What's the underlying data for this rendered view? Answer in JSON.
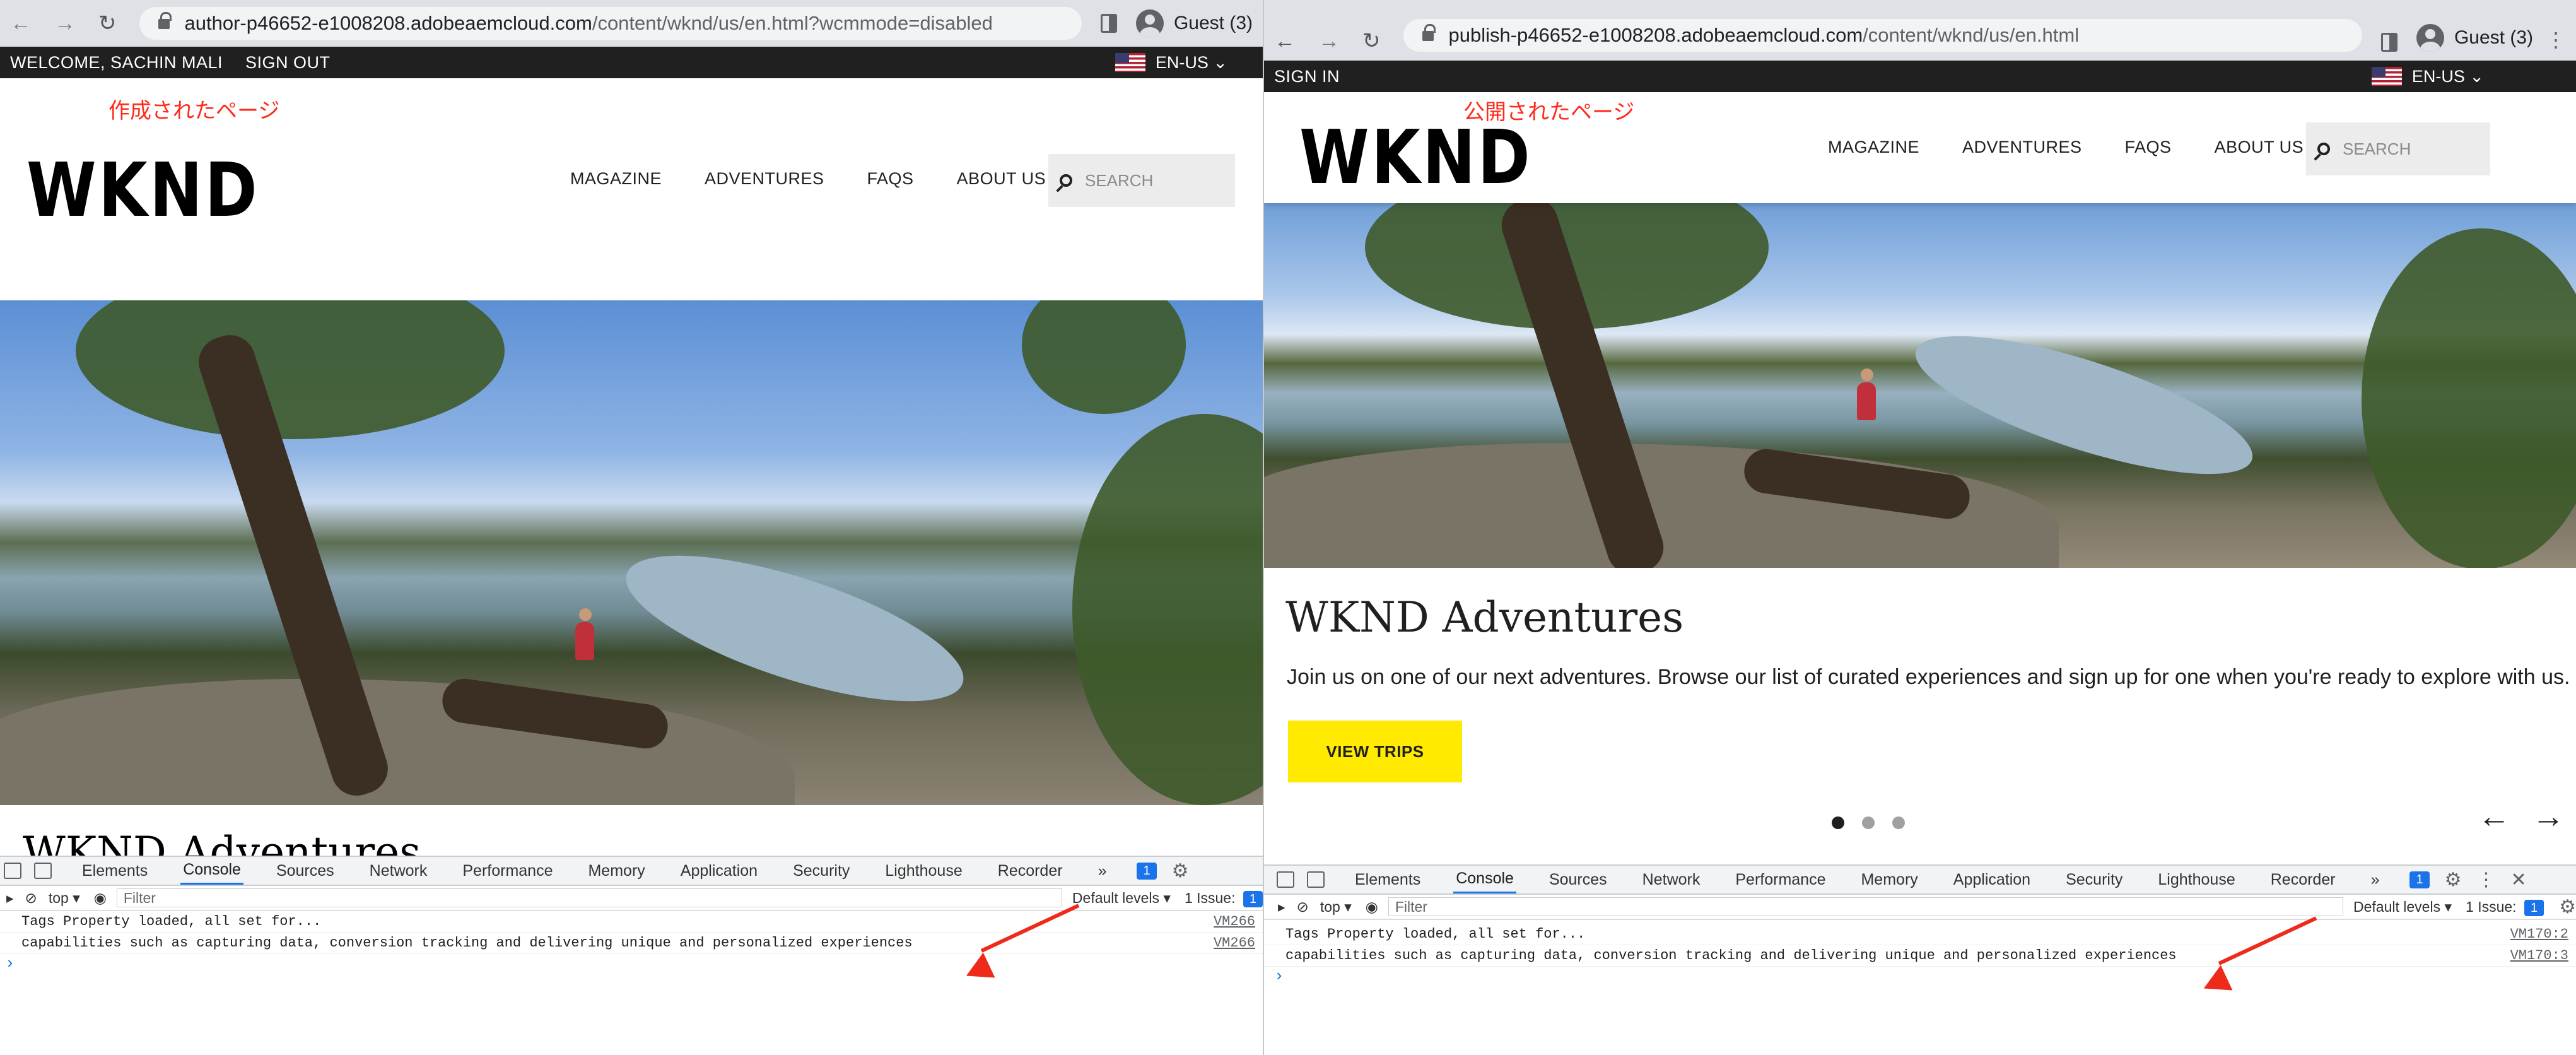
{
  "left": {
    "browser": {
      "url_host": "author-p46652-e1008208.adobeaemcloud.com",
      "url_path": "/content/wknd/us/en.html?wcmmode=disabled",
      "profile": "Guest (3)"
    },
    "topbar": {
      "welcome": "WELCOME, SACHIN MALI",
      "signout": "SIGN OUT",
      "lang": "EN-US"
    },
    "annotation": "作成されたページ",
    "logo": "WKND",
    "nav": [
      "MAGAZINE",
      "ADVENTURES",
      "FAQS",
      "ABOUT US"
    ],
    "search_placeholder": "SEARCH",
    "peek_title": "WKND Adventures",
    "devtools": {
      "tabs": [
        "Elements",
        "Console",
        "Sources",
        "Network",
        "Performance",
        "Memory",
        "Application",
        "Security",
        "Lighthouse",
        "Recorder"
      ],
      "issues_count": "1",
      "context": "top",
      "filter_placeholder": "Filter",
      "levels": "Default levels",
      "issue_label": "1 Issue:",
      "issue_count": "1",
      "lines": [
        {
          "text": "Tags Property loaded, all set for...",
          "src": "VM266"
        },
        {
          "text": "capabilities such as capturing data, conversion tracking and delivering unique and personalized experiences",
          "src": "VM266"
        }
      ],
      "prompt": "›"
    }
  },
  "right": {
    "browser": {
      "url_host": "publish-p46652-e1008208.adobeaemcloud.com",
      "url_path": "/content/wknd/us/en.html",
      "profile": "Guest (3)"
    },
    "topbar": {
      "signin": "SIGN IN",
      "lang": "EN-US"
    },
    "annotation": "公開されたページ",
    "logo": "WKND",
    "nav": [
      "MAGAZINE",
      "ADVENTURES",
      "FAQS",
      "ABOUT US"
    ],
    "search_placeholder": "SEARCH",
    "hero": {
      "title": "WKND Adventures",
      "text": "Join us on one of our next adventures. Browse our list of curated experiences and sign up for one when you're ready to explore with us.",
      "button": "VIEW TRIPS",
      "slides_total": 3,
      "active_slide": 1
    },
    "devtools": {
      "tabs": [
        "Elements",
        "Console",
        "Sources",
        "Network",
        "Performance",
        "Memory",
        "Application",
        "Security",
        "Lighthouse",
        "Recorder"
      ],
      "issues_count": "1",
      "context": "top",
      "filter_placeholder": "Filter",
      "levels": "Default levels",
      "issue_label": "1 Issue:",
      "issue_count": "1",
      "lines": [
        {
          "text": "Tags Property loaded, all set for...",
          "src": "VM170:2"
        },
        {
          "text": "capabilities such as capturing data, conversion tracking and delivering unique and personalized experiences",
          "src": "VM170:3"
        }
      ],
      "prompt": "›"
    }
  },
  "colors": {
    "accent": "#1a73e8",
    "cta": "#ffea00",
    "annotation": "#ff2a1a",
    "topbar": "#202020"
  }
}
